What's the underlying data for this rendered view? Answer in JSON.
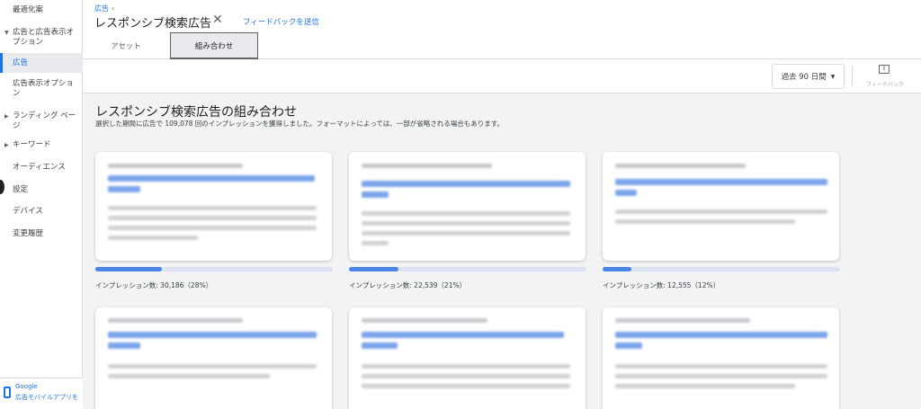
{
  "sidebar": {
    "items": [
      {
        "label": "最適化案"
      },
      {
        "label": "広告と広告表示オプション"
      },
      {
        "label": "広告"
      },
      {
        "label": "広告表示オプション"
      },
      {
        "label": "ランディング ページ"
      },
      {
        "label": "キーワード"
      },
      {
        "label": "オーディエンス"
      },
      {
        "label": "設定"
      },
      {
        "label": "デバイス"
      },
      {
        "label": "変更履歴"
      }
    ],
    "promo": {
      "line1": "Google",
      "line2": "広告モバイルアプリを"
    }
  },
  "header": {
    "breadcrumb": "広告",
    "breadcrumb_sep": "›",
    "title": "レスポンシブ検索広告",
    "close": "✕",
    "feedback_link": "フィードバックを送信",
    "tabs": [
      {
        "label": "アセット"
      },
      {
        "label": "組み合わせ"
      }
    ]
  },
  "toolbar": {
    "date_range": "過去 90 日間",
    "date_arrow": "▼",
    "feedback_icon": "!",
    "feedback_label": "フィードバック"
  },
  "section": {
    "title": "レスポンシブ検索広告の組み合わせ",
    "subtitle": "選択した期間に広告で 109,078 回のインプレッションを獲得しました。フォーマットによっては、一部が省略される場合もあります。"
  },
  "cards": [
    {
      "impressions": "インプレッション数: 30,186（28%）",
      "share": 0.28
    },
    {
      "impressions": "インプレッション数: 22,539（21%）",
      "share": 0.21
    },
    {
      "impressions": "インプレッション数: 12,555（12%）",
      "share": 0.12
    }
  ],
  "colors": {
    "accent": "#1a73e8",
    "bar": "#4a86e8",
    "track": "#dbe3f3"
  }
}
